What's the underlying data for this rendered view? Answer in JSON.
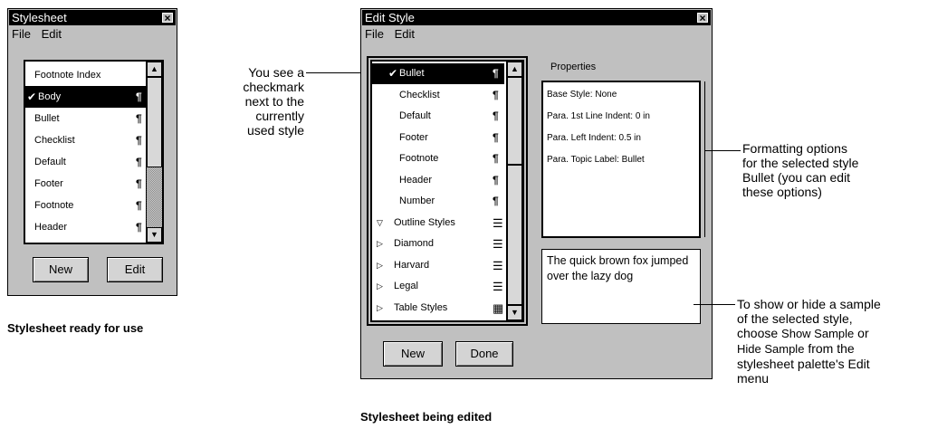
{
  "left_window": {
    "title": "Stylesheet",
    "menu": [
      "File",
      "Edit"
    ],
    "items": [
      {
        "label": "Footnote Index",
        "pilcrow": ""
      },
      {
        "label": "Body",
        "pilcrow": "¶",
        "checked": "✔"
      },
      {
        "label": "Bullet",
        "pilcrow": "¶"
      },
      {
        "label": "Checklist",
        "pilcrow": "¶"
      },
      {
        "label": "Default",
        "pilcrow": "¶"
      },
      {
        "label": "Footer",
        "pilcrow": "¶"
      },
      {
        "label": "Footnote",
        "pilcrow": "¶"
      },
      {
        "label": "Header",
        "pilcrow": "¶"
      }
    ],
    "new_label": "New",
    "edit_label": "Edit"
  },
  "left_caption": "Stylesheet ready for use",
  "check_note": [
    "You see a",
    "checkmark",
    "next to the",
    "currently",
    "used style"
  ],
  "right_window": {
    "title": "Edit Style",
    "menu": [
      "File",
      "Edit"
    ],
    "items": [
      {
        "label": "Bullet",
        "glyph": "¶",
        "checked": "✔"
      },
      {
        "label": "Checklist",
        "glyph": "¶"
      },
      {
        "label": "Default",
        "glyph": "¶"
      },
      {
        "label": "Footer",
        "glyph": "¶"
      },
      {
        "label": "Footnote",
        "glyph": "¶"
      },
      {
        "label": "Header",
        "glyph": "¶"
      },
      {
        "label": "Number",
        "glyph": "¶"
      },
      {
        "label": "Outline Styles",
        "glyph": "☰",
        "tri": "▽"
      },
      {
        "label": "Diamond",
        "glyph": "☰",
        "tri": "▷"
      },
      {
        "label": "Harvard",
        "glyph": "☰",
        "tri": "▷"
      },
      {
        "label": "Legal",
        "glyph": "☰",
        "tri": "▷"
      },
      {
        "label": "Table Styles",
        "glyph": "▦",
        "tri": "▷"
      }
    ],
    "properties_heading": "Properties",
    "properties": [
      "Base Style: None",
      "Para. 1st Line Indent: 0 in",
      "Para. Left Indent: 0.5 in",
      "Para. Topic Label: Bullet"
    ],
    "sample_text": "The quick brown fox jumped over the lazy dog",
    "new_label": "New",
    "done_label": "Done"
  },
  "right_caption": "Stylesheet being edited",
  "format_note": [
    "Formatting options",
    "for the selected style",
    "Bullet (you can edit",
    "these options)"
  ],
  "sample_note": {
    "l1": "To show or hide a sample",
    "l2": "of the selected style,",
    "l3a": "choose ",
    "l3b": "Show Sample",
    "l3c": " or",
    "l4a": "Hide Sample",
    "l4b": " from the",
    "l5": "stylesheet palette's Edit",
    "l6": "menu"
  }
}
